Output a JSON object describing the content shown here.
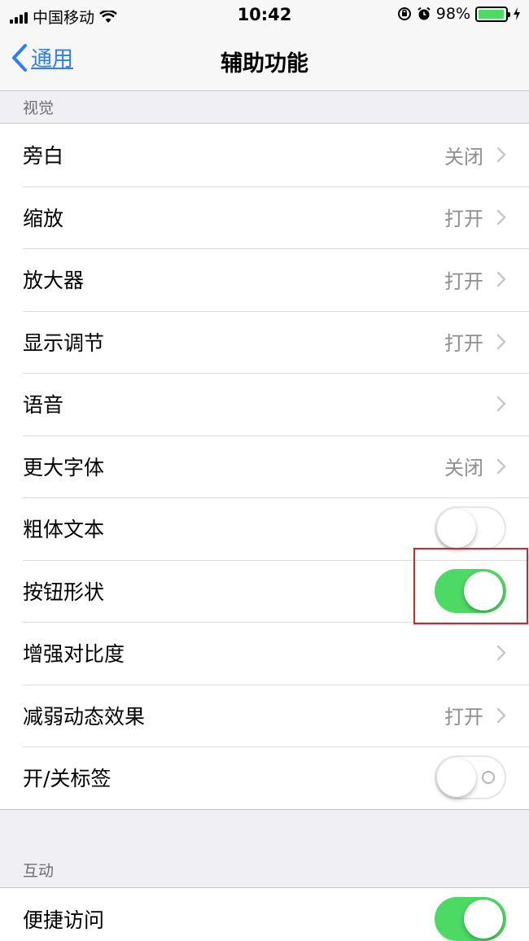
{
  "status_bar": {
    "carrier": "中国移动",
    "time": "10:42",
    "battery_percent": "98%",
    "battery_level": 0.98,
    "icons": [
      "signal-icon",
      "wifi-icon",
      "rotation-lock-icon",
      "alarm-icon",
      "battery-icon",
      "charging-bolt-icon"
    ]
  },
  "nav": {
    "back_label": "通用",
    "title": "辅助功能"
  },
  "sections": {
    "vision": {
      "header": "视觉",
      "rows": [
        {
          "label": "旁白",
          "value": "关闭"
        },
        {
          "label": "缩放",
          "value": "打开"
        },
        {
          "label": "放大器",
          "value": "打开"
        },
        {
          "label": "显示调节",
          "value": "打开"
        },
        {
          "label": "语音",
          "value": ""
        },
        {
          "label": "更大字体",
          "value": "关闭"
        },
        {
          "label": "粗体文本",
          "toggle": false
        },
        {
          "label": "按钮形状",
          "toggle": true
        },
        {
          "label": "增强对比度",
          "value": ""
        },
        {
          "label": "减弱动态效果",
          "value": "打开"
        },
        {
          "label": "开/关标签",
          "toggle": false
        }
      ]
    },
    "interaction": {
      "header": "互动",
      "rows": [
        {
          "label": "便捷访问",
          "toggle": true
        }
      ]
    }
  },
  "colors": {
    "accent": "#2f7cf6",
    "toggle_on": "#4cd964",
    "highlight": "#d1262b"
  }
}
